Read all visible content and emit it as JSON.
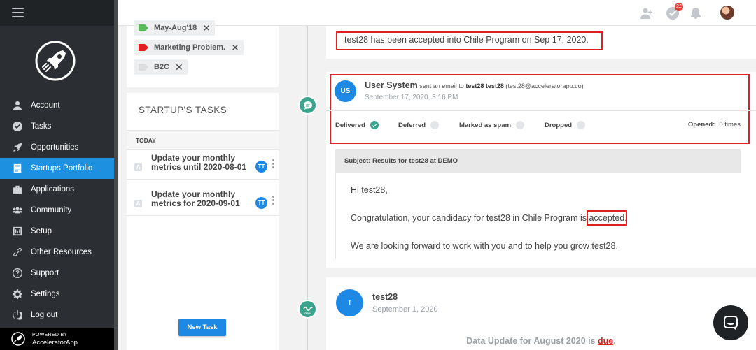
{
  "sidebar": {
    "items": [
      {
        "label": "Account",
        "icon": "user-icon"
      },
      {
        "label": "Tasks",
        "icon": "check-circle-icon"
      },
      {
        "label": "Opportunities",
        "icon": "rocket-icon"
      },
      {
        "label": "Startups Portfolio",
        "icon": "portfolio-icon",
        "active": true
      },
      {
        "label": "Applications",
        "icon": "applications-icon"
      },
      {
        "label": "Community",
        "icon": "community-icon"
      },
      {
        "label": "Setup",
        "icon": "sliders-icon"
      },
      {
        "label": "Other Resources",
        "icon": "link-icon"
      },
      {
        "label": "Support",
        "icon": "question-icon"
      },
      {
        "label": "Settings",
        "icon": "gear-icon"
      },
      {
        "label": "Log out",
        "icon": "power-icon"
      }
    ],
    "powered_small": "POWERED BY",
    "powered_brand": "AcceleratorApp"
  },
  "topbar": {
    "notifications_badge": "22"
  },
  "tags": [
    {
      "label": "May-Aug'18",
      "color": "#5cb85c"
    },
    {
      "label": "Marketing Problem.",
      "color": "#e02020"
    },
    {
      "label": "B2C",
      "color": "#dddddd"
    }
  ],
  "tasks_panel": {
    "title": "STARTUP'S TASKS",
    "section": "TODAY",
    "items": [
      {
        "text": "Update your monthly metrics until 2020-08-01",
        "badge": "A",
        "assignee": "TT"
      },
      {
        "text": "Update your monthly metrics for 2020-09-01",
        "badge": "A",
        "assignee": "TT"
      }
    ],
    "new_task_label": "New Task"
  },
  "feed": {
    "accepted_message": "test28 has been accepted into Chile Program on Sep 17, 2020.",
    "email": {
      "avatar": "US",
      "sender": "User System",
      "action": "sent an email to",
      "recipient": "test28 test28",
      "recipient_email": "(test28@acceleratorapp.co)",
      "date": "September 17, 2020, 3:16 PM",
      "statuses": {
        "delivered": "Delivered",
        "deferred": "Deferred",
        "spam": "Marked as spam",
        "dropped": "Dropped",
        "opened_label": "Opened:",
        "opened_value": "0 times"
      },
      "subject": "Subject: Results for test28 at DEMO",
      "greeting": "Hi test28,",
      "body_before": "Congratulation, your candidacy for test28 in Chile Program is ",
      "body_highlight": "accepted",
      "body_after": ".",
      "closing": "We are looking forward to work with you and to help you grow test28."
    },
    "data_update": {
      "avatar": "T",
      "name": "test28",
      "date": "September 1, 2020",
      "text": "Data Update for August 2020 is ",
      "due": "due",
      "suffix": "."
    }
  },
  "colors": {
    "accent": "#1e88e5",
    "sidebar_bg": "#2b2f33",
    "timeline_node": "#3aa58c",
    "highlight_red": "#e02020"
  }
}
